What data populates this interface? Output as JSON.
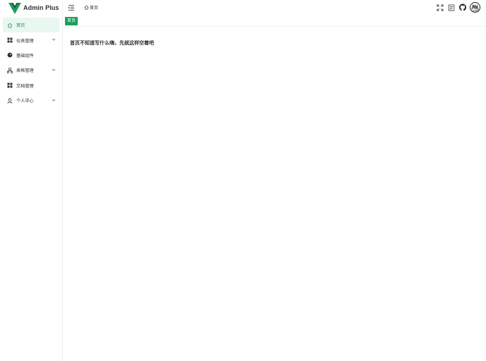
{
  "app": {
    "title": "Admin Plus",
    "brand_color": "#18a058",
    "brand_dark": "#35495e"
  },
  "sidebar": {
    "items": [
      {
        "label": "首页",
        "icon": "home-icon",
        "active": true,
        "expandable": false
      },
      {
        "label": "仪表管理",
        "icon": "grid-icon",
        "active": false,
        "expandable": true
      },
      {
        "label": "基础组件",
        "icon": "dashboard-icon",
        "active": false,
        "expandable": false
      },
      {
        "label": "表格管理",
        "icon": "table-icon",
        "active": false,
        "expandable": true
      },
      {
        "label": "文档管理",
        "icon": "grid-icon",
        "active": false,
        "expandable": false
      },
      {
        "label": "个人中心",
        "icon": "user-icon",
        "active": false,
        "expandable": true
      }
    ]
  },
  "header": {
    "breadcrumb": "首页",
    "tools": [
      "fullscreen-icon",
      "document-icon",
      "github-icon",
      "avatar"
    ]
  },
  "tags": {
    "items": [
      {
        "label": "首页",
        "active": true
      }
    ]
  },
  "main": {
    "text": "首页不知道写什么嗨，先就这样空着吧"
  }
}
